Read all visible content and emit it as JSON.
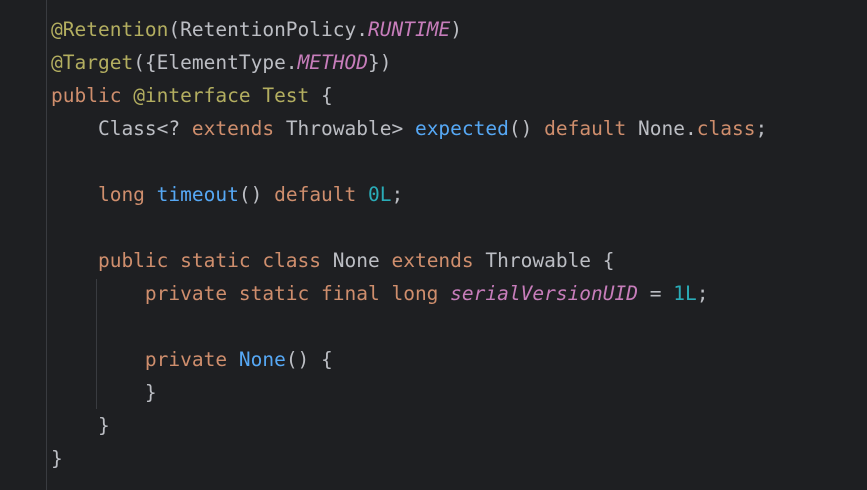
{
  "editor": {
    "lines": [
      {
        "tokens": [
          {
            "type": "annotation",
            "text": "@Retention"
          },
          {
            "type": "plain",
            "text": "(RetentionPolicy."
          },
          {
            "type": "constant",
            "text": "RUNTIME"
          },
          {
            "type": "plain",
            "text": ")"
          }
        ]
      },
      {
        "tokens": [
          {
            "type": "annotation",
            "text": "@Target"
          },
          {
            "type": "plain",
            "text": "({ElementType."
          },
          {
            "type": "constant",
            "text": "METHOD"
          },
          {
            "type": "plain",
            "text": "})"
          }
        ]
      },
      {
        "tokens": [
          {
            "type": "keyword",
            "text": "public "
          },
          {
            "type": "annotation",
            "text": "@interface Test"
          },
          {
            "type": "plain",
            "text": " {"
          }
        ]
      },
      {
        "tokens": [
          {
            "type": "plain",
            "text": "    Class<? "
          },
          {
            "type": "keyword",
            "text": "extends "
          },
          {
            "type": "plain",
            "text": "Throwable> "
          },
          {
            "type": "method-decl",
            "text": "expected"
          },
          {
            "type": "plain",
            "text": "() "
          },
          {
            "type": "keyword",
            "text": "default "
          },
          {
            "type": "plain",
            "text": "None."
          },
          {
            "type": "keyword",
            "text": "class"
          },
          {
            "type": "plain",
            "text": ";"
          }
        ]
      },
      {
        "tokens": []
      },
      {
        "tokens": [
          {
            "type": "keyword",
            "text": "    long "
          },
          {
            "type": "method-decl",
            "text": "timeout"
          },
          {
            "type": "plain",
            "text": "() "
          },
          {
            "type": "keyword",
            "text": "default "
          },
          {
            "type": "number",
            "text": "0L"
          },
          {
            "type": "plain",
            "text": ";"
          }
        ]
      },
      {
        "tokens": []
      },
      {
        "tokens": [
          {
            "type": "keyword",
            "text": "    public static class "
          },
          {
            "type": "plain",
            "text": "None "
          },
          {
            "type": "keyword",
            "text": "extends "
          },
          {
            "type": "plain",
            "text": "Throwable {"
          }
        ]
      },
      {
        "tokens": [
          {
            "type": "keyword",
            "text": "        private static final long "
          },
          {
            "type": "constant",
            "text": "serialVersionUID"
          },
          {
            "type": "plain",
            "text": " = "
          },
          {
            "type": "number",
            "text": "1L"
          },
          {
            "type": "plain",
            "text": ";"
          }
        ]
      },
      {
        "tokens": []
      },
      {
        "tokens": [
          {
            "type": "keyword",
            "text": "        private "
          },
          {
            "type": "method-decl",
            "text": "None"
          },
          {
            "type": "plain",
            "text": "() {"
          }
        ]
      },
      {
        "tokens": [
          {
            "type": "plain",
            "text": "        }"
          }
        ]
      },
      {
        "tokens": [
          {
            "type": "plain",
            "text": "    }"
          }
        ]
      },
      {
        "tokens": [
          {
            "type": "plain",
            "text": "}"
          }
        ]
      }
    ]
  },
  "colors": {
    "background": "#1e1f22",
    "plain": "#bcbec4",
    "annotation": "#b3ae60",
    "keyword": "#cf8e6d",
    "constant": "#c77dbb",
    "method_declaration": "#56a8f5",
    "number": "#2aacb8"
  }
}
